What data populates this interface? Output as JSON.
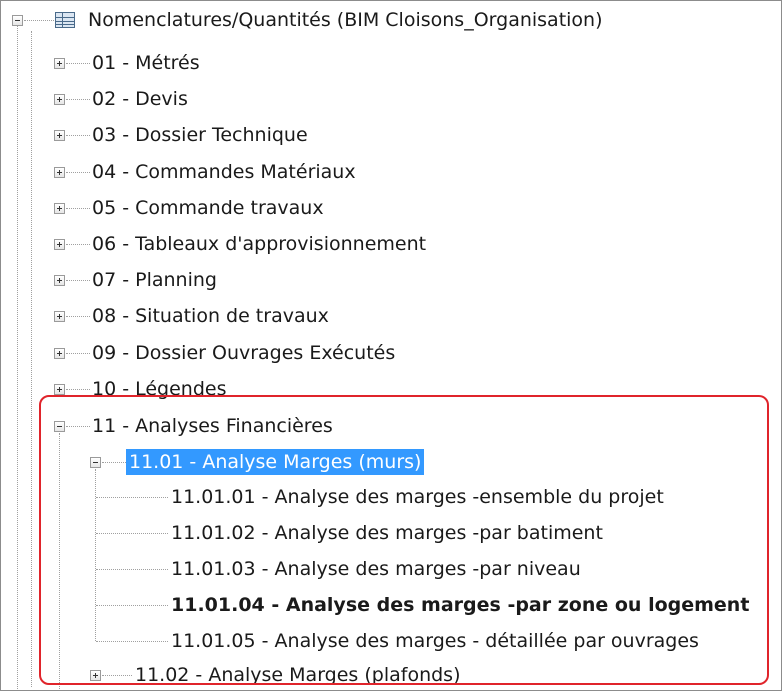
{
  "tree": {
    "root": {
      "label": "Nomenclatures/Quantités (BIM Cloisons_Organisation)",
      "icon": "table-icon"
    },
    "categories": [
      "01 - Métrés",
      "02 - Devis",
      "03 - Dossier Technique",
      "04 - Commandes Matériaux",
      "05 - Commande travaux",
      "06 - Tableaux d'approvisionnement",
      "07 - Planning",
      "08 - Situation de travaux",
      "09 - Dossier Ouvrages Exécutés",
      "10 - Légendes"
    ],
    "expanded_category": {
      "label": "11 - Analyses Financières",
      "subgroup": {
        "label": "11.01 - Analyse Marges (murs)",
        "selected": true,
        "items": [
          {
            "label": "11.01.01 - Analyse des marges -ensemble du projet",
            "bold": false
          },
          {
            "label": "11.01.02 - Analyse des marges -par batiment",
            "bold": false
          },
          {
            "label": "11.01.03 - Analyse des marges -par niveau",
            "bold": false
          },
          {
            "label": "11.01.04 - Analyse des marges -par zone ou logement",
            "bold": true
          },
          {
            "label": "11.01.05 - Analyse des marges - détaillée par ouvrages",
            "bold": false
          }
        ]
      },
      "next_subgroup": {
        "label": "11.02 - Analyse Marges (plafonds)"
      }
    },
    "colors": {
      "selection": "#3399ff",
      "highlight_border": "#e0242b"
    }
  }
}
